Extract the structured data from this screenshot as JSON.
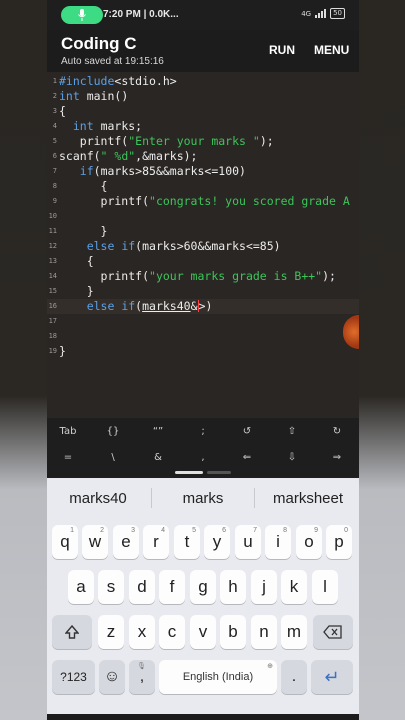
{
  "status_bar": {
    "time_carrier": "7:20 PM | 0.0K...",
    "network": "4G",
    "battery": "50"
  },
  "appbar": {
    "title": "Coding C",
    "subtitle": "Auto saved at 19:15:16",
    "run_label": "RUN",
    "menu_label": "MENU"
  },
  "editor": {
    "lines": [
      {
        "n": "1",
        "code": "#include<stdio.h>"
      },
      {
        "n": "2",
        "code": "int main()"
      },
      {
        "n": "3",
        "code": "{"
      },
      {
        "n": "4",
        "code": "  int marks;"
      },
      {
        "n": "5",
        "code": "   printf(\"Enter your marks \");"
      },
      {
        "n": "6",
        "code": "scanf(\" %d\",&marks);"
      },
      {
        "n": "7",
        "code": "   if(marks>85&&marks<=100)"
      },
      {
        "n": "8",
        "code": "      {"
      },
      {
        "n": "9",
        "code": "      printf(\"congrats! you scored grade A"
      },
      {
        "n": "10",
        "code": ""
      },
      {
        "n": "11",
        "code": "      }"
      },
      {
        "n": "12",
        "code": "    else if(marks>60&&marks<=85)"
      },
      {
        "n": "13",
        "code": "    {"
      },
      {
        "n": "14",
        "code": "      printf(\"your marks grade is B++\");"
      },
      {
        "n": "15",
        "code": "    }"
      },
      {
        "n": "16",
        "code": "    else if(marks40&>)"
      },
      {
        "n": "17",
        "code": ""
      },
      {
        "n": "18",
        "code": ""
      },
      {
        "n": "19",
        "code": "}"
      }
    ]
  },
  "extra_keys": {
    "row1": [
      "Tab",
      "{}",
      "“”",
      ";",
      "↺",
      "⇧",
      "↻"
    ],
    "row2": [
      "=",
      "\\",
      "&",
      ",",
      "⇐",
      "⇩",
      "⇒"
    ]
  },
  "keyboard": {
    "suggestions": [
      "marks40",
      "marks",
      "marksheet"
    ],
    "row1": [
      "q",
      "w",
      "e",
      "r",
      "t",
      "y",
      "u",
      "i",
      "o",
      "p"
    ],
    "row1_hints": [
      "1",
      "2",
      "3",
      "4",
      "5",
      "6",
      "7",
      "8",
      "9",
      "0"
    ],
    "row2": [
      "a",
      "s",
      "d",
      "f",
      "g",
      "h",
      "j",
      "k",
      "l"
    ],
    "row3": [
      "z",
      "x",
      "c",
      "v",
      "b",
      "n",
      "m"
    ],
    "symbols_label": "?123",
    "emoji_label": "☺",
    "comma_label": ",",
    "space_label": "English (India)",
    "period_label": ".",
    "enter_label": "↵"
  },
  "colors": {
    "keyword": "#5aa0e6",
    "string": "#3cc55a",
    "accent_green": "#3ddc84"
  }
}
